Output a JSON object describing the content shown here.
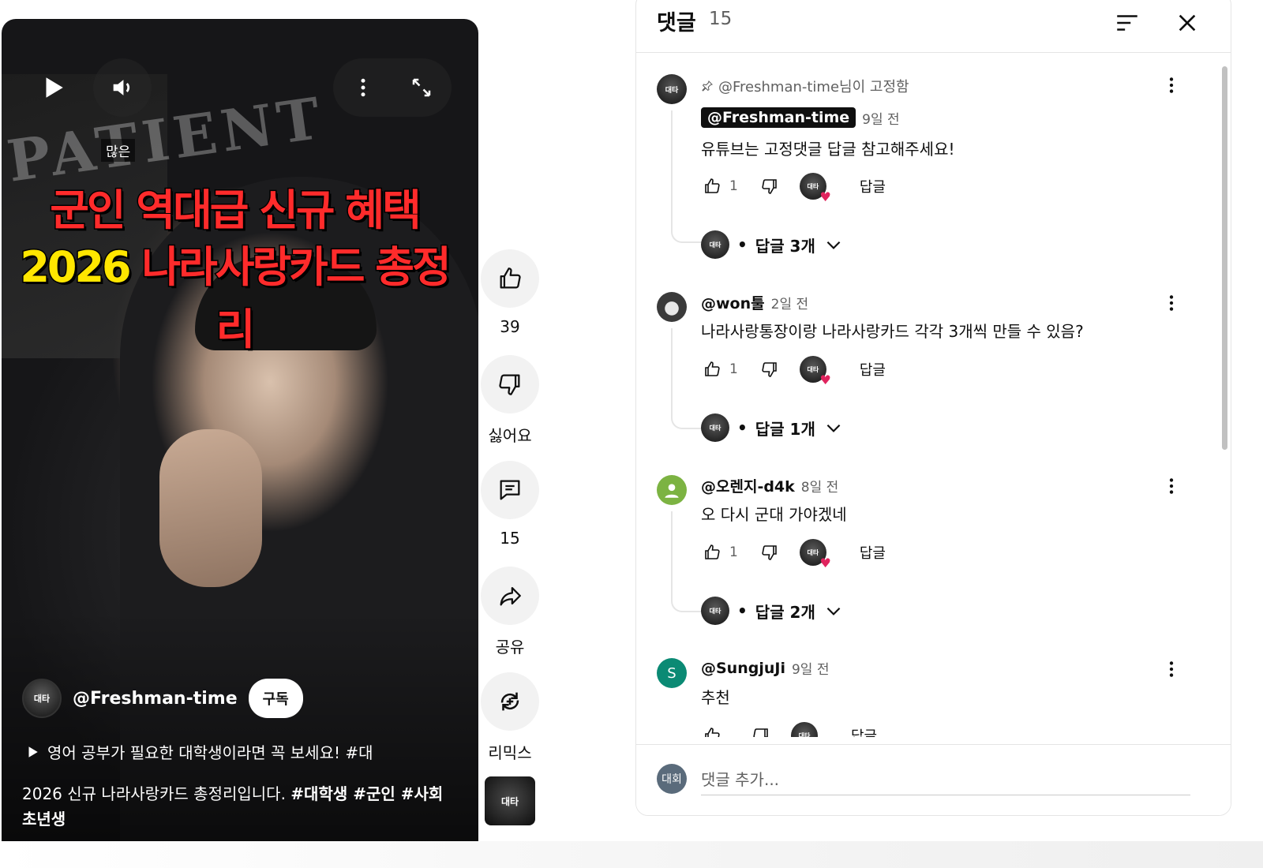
{
  "video": {
    "tag": "많은",
    "title_line1": "군인 역대급 신규 혜택",
    "title_line2_year": "2026",
    "title_line2_rest": "나라사랑카드 총정리",
    "background_text": "PATIENT",
    "channel_avatar_text": "대타",
    "channel_name": "@Freshman-time",
    "subscribe_label": "구독",
    "playlist_text": "영어 공부가 필요한 대학생이라면 꼭 보세요! #대",
    "description_plain": "2026 신규 나라사랑카드 총정리입니다. ",
    "description_tags": "#대학생 #군인 #사회초년생",
    "controls": {
      "play": "play-icon",
      "mute": "volume-icon",
      "more": "more-vert-icon",
      "fullscreen": "expand-icon"
    }
  },
  "rail": {
    "like_count": "39",
    "dislike_label": "싫어요",
    "comment_count": "15",
    "share_label": "공유",
    "remix_label": "리믹스",
    "thumb_text": "대타"
  },
  "comments_panel": {
    "title": "댓글",
    "count": "15",
    "input_placeholder": "댓글 추가...",
    "user_avatar_text": "대회",
    "comments": [
      {
        "pinned_text": "@Freshman-time님이 고정함",
        "author": "@Freshman-time",
        "time": "9일 전",
        "text": "유튜브는 고정댓글 답글 참고해주세요!",
        "likes": "1",
        "reply_label": "답글",
        "replies_label": "답글 3개",
        "avatar_text": "대타",
        "avatar_color": "#1a1a1a"
      },
      {
        "author": "@won툴",
        "time": "2일 전",
        "text": "나라사랑통장이랑 나라사랑카드 각각 3개씩 만들 수 있음?",
        "likes": "1",
        "reply_label": "답글",
        "replies_label": "답글 1개",
        "avatar_text": "",
        "avatar_color": "#3a3a3a"
      },
      {
        "author": "@오렌지-d4k",
        "time": "8일 전",
        "text": "오 다시 군대 가야겠네",
        "likes": "1",
        "reply_label": "답글",
        "replies_label": "답글 2개",
        "avatar_text": "",
        "avatar_color": "#7cb342"
      },
      {
        "author": "@SungjuJi",
        "time": "9일 전",
        "text": "추천",
        "likes": "",
        "reply_label": "답글",
        "avatar_text": "S",
        "avatar_color": "#0b8a74"
      }
    ]
  }
}
